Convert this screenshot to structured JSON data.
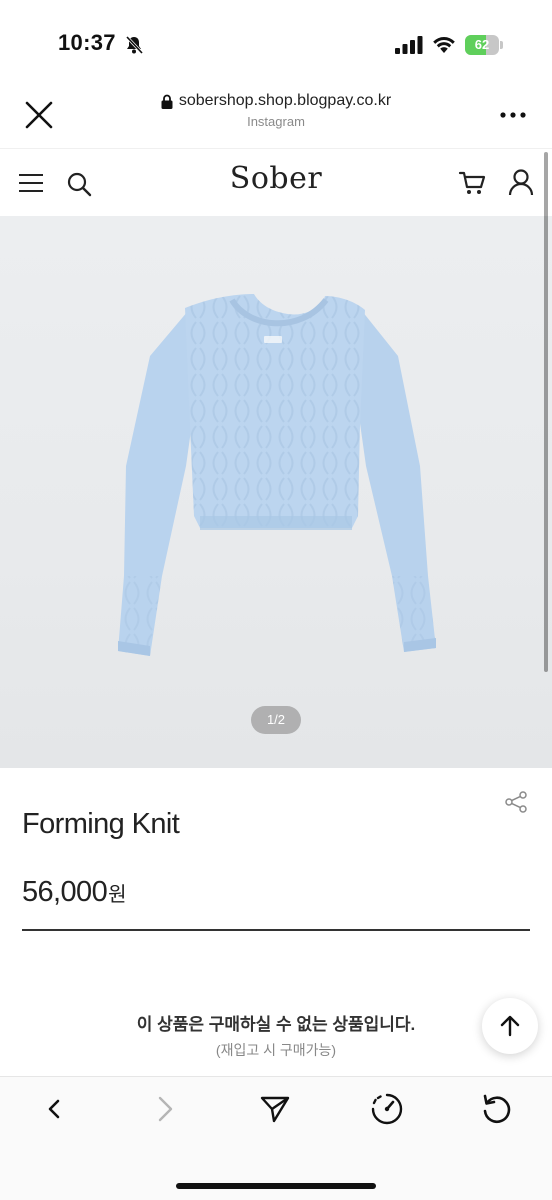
{
  "status": {
    "time": "10:37",
    "battery_level": "62",
    "battery_fraction": 0.62,
    "colors": {
      "battery_fill": "#5fcf5b"
    }
  },
  "browser": {
    "url": "sobershop.shop.blogpay.co.kr",
    "source": "Instagram"
  },
  "site": {
    "logo": "Sober"
  },
  "product": {
    "image_pager": "1/2",
    "name": "Forming Knit",
    "price": "56,000",
    "currency": "원",
    "unavailable_message": "이 상품은 구매하실 수 없는 상품입니다.",
    "restock_note": "(재입고 시 구매가능)"
  },
  "icons": {
    "status": [
      "mute-icon",
      "signal-icon",
      "wifi-icon",
      "battery-icon"
    ],
    "browser": [
      "close-icon",
      "lock-icon",
      "more-icon"
    ],
    "header": [
      "menu-icon",
      "search-icon",
      "cart-icon",
      "user-icon"
    ],
    "page": [
      "share-icon",
      "arrow-up-icon"
    ],
    "toolbar": [
      "chevron-left-icon",
      "chevron-right-icon",
      "send-icon",
      "speedometer-icon",
      "reload-icon"
    ]
  },
  "theme": {
    "sweater_color": "#b9d3ee",
    "image_background": "#e9ebed"
  }
}
